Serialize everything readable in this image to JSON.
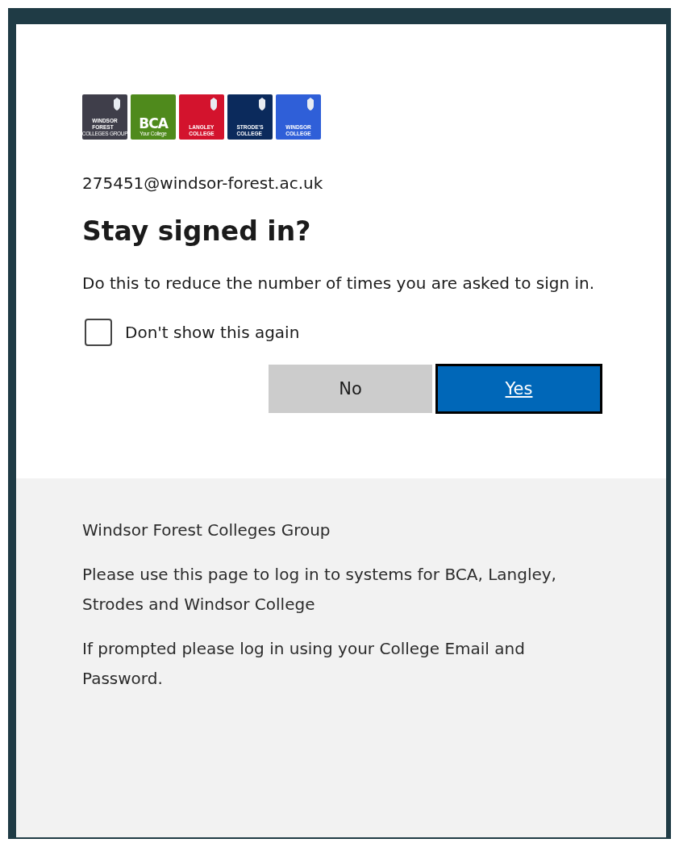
{
  "logos": [
    {
      "lines": [
        "WINDSOR",
        "FOREST"
      ],
      "small": "COLLEGES GROUP",
      "color": "#3f3e4a"
    },
    {
      "lines": [
        "BCA"
      ],
      "small": "Your College",
      "color": "#4f8a1c"
    },
    {
      "lines": [
        "LANGLEY",
        "COLLEGE"
      ],
      "color": "#d3132d"
    },
    {
      "lines": [
        "STRODE'S",
        "COLLEGE"
      ],
      "color": "#0b2a5c"
    },
    {
      "lines": [
        "WINDSOR",
        "COLLEGE"
      ],
      "color": "#2f5fd8"
    }
  ],
  "email": "275451@windsor-forest.ac.uk",
  "title": "Stay signed in?",
  "description": "Do this to reduce the number of times you are asked to sign in.",
  "checkbox": {
    "label": "Don't show this again",
    "checked": false
  },
  "buttons": [
    {
      "label": "No",
      "kind": "secondary"
    },
    {
      "label": "Yes",
      "kind": "primary"
    }
  ],
  "footer": {
    "heading": "Windsor Forest Colleges Group",
    "paragraphs": [
      "Please use this page to log in to systems for BCA, Langley, Strodes and Windsor College",
      "If prompted please log in using your College Email and Password."
    ]
  }
}
